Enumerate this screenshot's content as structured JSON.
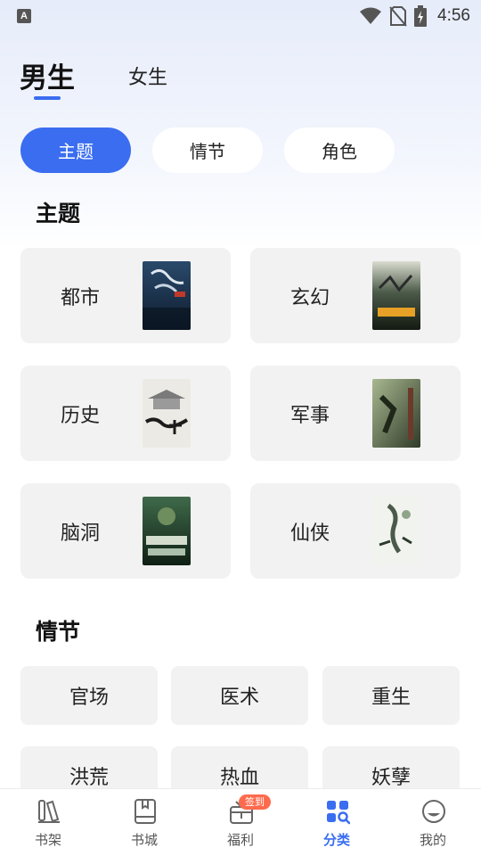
{
  "status_bar": {
    "left_icon_letter": "A",
    "time": "4:56",
    "icons": [
      "wifi-icon",
      "no-sim-icon",
      "battery-icon"
    ]
  },
  "gender_tabs": [
    {
      "label": "男生",
      "active": true
    },
    {
      "label": "女生",
      "active": false
    }
  ],
  "filter_pills": [
    {
      "label": "主题",
      "active": true
    },
    {
      "label": "情节",
      "active": false
    },
    {
      "label": "角色",
      "active": false
    }
  ],
  "sections": {
    "theme": {
      "title": "主题",
      "items": [
        {
          "label": "都市",
          "cover": "book-cover-icon"
        },
        {
          "label": "玄幻",
          "cover": "book-cover-icon"
        },
        {
          "label": "历史",
          "cover": "book-cover-icon"
        },
        {
          "label": "军事",
          "cover": "book-cover-icon"
        },
        {
          "label": "脑洞",
          "cover": "book-cover-icon"
        },
        {
          "label": "仙侠",
          "cover": "book-cover-icon"
        }
      ]
    },
    "plot": {
      "title": "情节",
      "items": [
        "官场",
        "医术",
        "重生",
        "洪荒",
        "热血",
        "妖孽"
      ]
    }
  },
  "bottom_nav": [
    {
      "label": "书架",
      "icon": "bookshelf-icon",
      "active": false
    },
    {
      "label": "书城",
      "icon": "book-icon",
      "active": false
    },
    {
      "label": "福利",
      "icon": "gift-icon",
      "active": false,
      "badge": "签到"
    },
    {
      "label": "分类",
      "icon": "category-icon",
      "active": true
    },
    {
      "label": "我的",
      "icon": "profile-icon",
      "active": false
    }
  ],
  "colors": {
    "accent": "#3a6df0",
    "badge": "#ff6a4d",
    "card_bg": "#f2f2f2"
  }
}
